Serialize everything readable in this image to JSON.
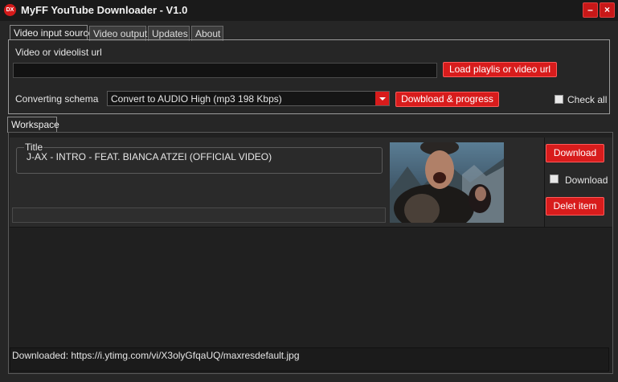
{
  "window": {
    "title": "MyFF YouTube Downloader - V1.0",
    "icon_label": "DX",
    "minimize_glyph": "–",
    "close_glyph": "×"
  },
  "tabs": [
    {
      "label": "Video input source",
      "active": true
    },
    {
      "label": "Video output",
      "active": false
    },
    {
      "label": "Updates",
      "active": false
    },
    {
      "label": "About",
      "active": false
    }
  ],
  "input_source": {
    "url_label": "Video or videolist url",
    "url_value": "",
    "load_button": "Load playlis or video url",
    "schema_label": "Converting schema",
    "schema_selected": "Convert to AUDIO High (mp3  198 Kbps)",
    "download_progress_button": "Dowbload & progress",
    "check_all_label": "Check all",
    "check_all_checked": false
  },
  "workspace": {
    "tab_label": "Workspace",
    "items": [
      {
        "title_legend": "Title",
        "title": "J-AX - INTRO - FEAT. BIANCA ATZEI (OFFICIAL VIDEO)",
        "download_button": "Download",
        "download_checkbox_label": "Download",
        "download_checked": false,
        "delete_button": "Delet item"
      }
    ]
  },
  "status": {
    "text": "Downloaded: https://i.ytimg.com/vi/X3olyGfqaUQ/maxresdefault.jpg"
  },
  "colors": {
    "accent": "#d81c1c",
    "background": "#262626",
    "titlebar": "#1a1a1a"
  }
}
